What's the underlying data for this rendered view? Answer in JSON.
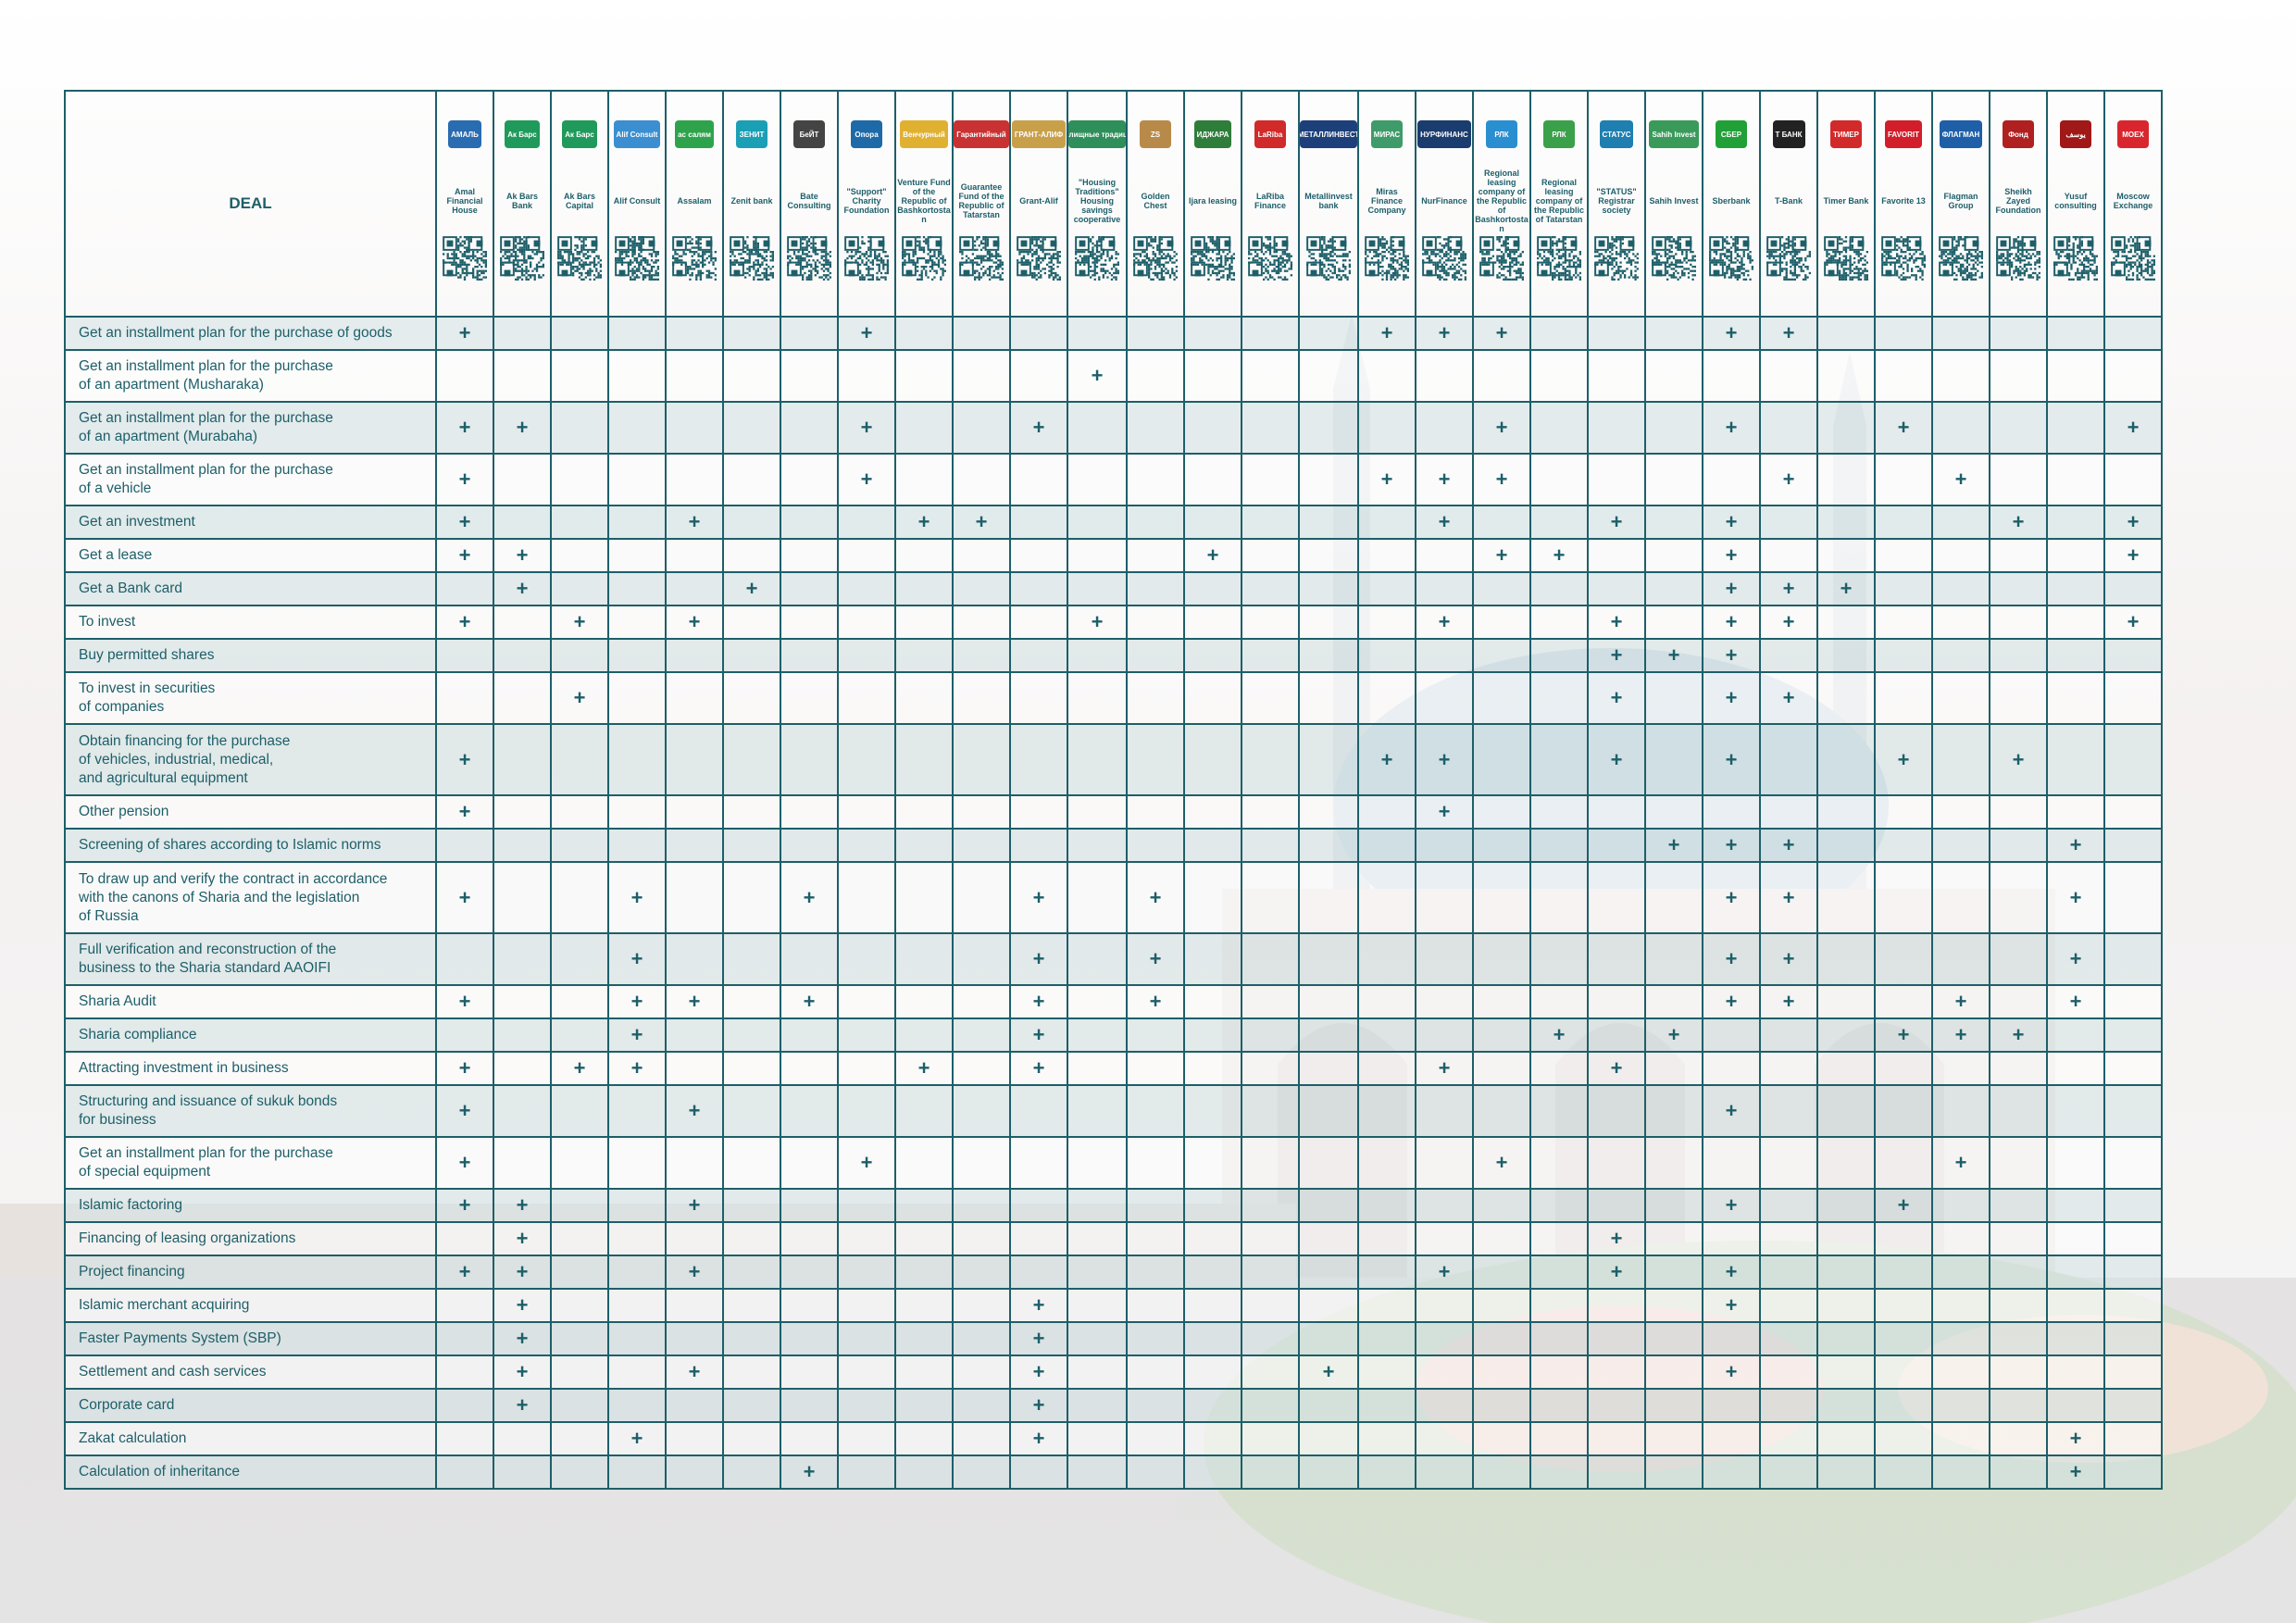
{
  "header_label": "DEAL",
  "colors": {
    "line": "#1d5f69",
    "text": "#1d5f69",
    "zebra": "#dfe9eb"
  },
  "organizations": [
    {
      "name": "Amal Financial House",
      "logo": "АМАЛЬ",
      "icon": "amal-logo-icon",
      "color": "#2a6cb0"
    },
    {
      "name": "Ak Bars Bank",
      "logo": "Ак Барс",
      "icon": "akbars-bank-logo-icon",
      "color": "#1f9a5a"
    },
    {
      "name": "Ak Bars Capital",
      "logo": "Ак Барс",
      "icon": "akbars-capital-logo-icon",
      "color": "#1f9a5a"
    },
    {
      "name": "Alif Consult",
      "logo": "Alif Consult",
      "icon": "alif-logo-icon",
      "color": "#3b8fd0"
    },
    {
      "name": "Assalam",
      "logo": "ас салям",
      "icon": "assalam-logo-icon",
      "color": "#2fa34c"
    },
    {
      "name": "Zenit bank",
      "logo": "ЗЕНИТ",
      "icon": "zenit-logo-icon",
      "color": "#1a9fb5"
    },
    {
      "name": "Bate Consulting",
      "logo": "БеЙТ",
      "icon": "bate-logo-icon",
      "color": "#444444"
    },
    {
      "name": "\"Support\" Charity Foundation",
      "logo": "Опора",
      "icon": "support-foundation-logo-icon",
      "color": "#1e6aa8"
    },
    {
      "name": "Venture Fund of the Republic of Bashkortostan",
      "logo": "Венчурный",
      "icon": "venture-fund-logo-icon",
      "color": "#e0b030"
    },
    {
      "name": "Guarantee Fund of the Republic of Tatarstan",
      "logo": "Гарантийный",
      "icon": "guarantee-fund-logo-icon",
      "color": "#c83232"
    },
    {
      "name": "Grant-Alif",
      "logo": "ГРАНТ-АЛИФ",
      "icon": "grant-alif-logo-icon",
      "color": "#c9a04a"
    },
    {
      "name": "\"Housing Traditions\" Housing savings cooperative",
      "logo": "Жилищные традиции",
      "icon": "housing-traditions-logo-icon",
      "color": "#2f8f5a"
    },
    {
      "name": "Golden Chest",
      "logo": "ZS",
      "icon": "golden-chest-logo-icon",
      "color": "#b88a4a"
    },
    {
      "name": "Ijara leasing",
      "logo": "ИДЖАРА",
      "icon": "ijara-logo-icon",
      "color": "#2f7d3a"
    },
    {
      "name": "LaRiba Finance",
      "logo": "LaRiba",
      "icon": "lariba-logo-icon",
      "color": "#d02a2a"
    },
    {
      "name": "Metallinvest bank",
      "logo": "МЕТАЛЛИНВЕСТ",
      "icon": "metallinvest-logo-icon",
      "color": "#1d3f7a"
    },
    {
      "name": "Miras Finance Company",
      "logo": "МИРАС",
      "icon": "miras-logo-icon",
      "color": "#3f9b6a"
    },
    {
      "name": "NurFinance",
      "logo": "НУРФИНАНС",
      "icon": "nurfinance-logo-icon",
      "color": "#1b3c6e"
    },
    {
      "name": "Regional leasing company of the Republic of Bashkortostan",
      "logo": "РЛК",
      "icon": "rlk-bashkortostan-logo-icon",
      "color": "#2a8fd0"
    },
    {
      "name": "Regional leasing company of the Republic of Tatarstan",
      "logo": "РЛК",
      "icon": "rlk-tatarstan-logo-icon",
      "color": "#3aa04a"
    },
    {
      "name": "\"STATUS\" Registrar society",
      "logo": "СТАТУС",
      "icon": "status-logo-icon",
      "color": "#1f7fb0"
    },
    {
      "name": "Sahih Invest",
      "logo": "Sahih Invest",
      "icon": "sahih-logo-icon",
      "color": "#3a9a5a"
    },
    {
      "name": "Sberbank",
      "logo": "СБЕР",
      "icon": "sber-logo-icon",
      "color": "#21a038"
    },
    {
      "name": "T-Bank",
      "logo": "Т БАНК",
      "icon": "tbank-logo-icon",
      "color": "#222222"
    },
    {
      "name": "Timer Bank",
      "logo": "ТИМЕР",
      "icon": "timer-bank-logo-icon",
      "color": "#d22a2a"
    },
    {
      "name": "Favorite 13",
      "logo": "FAVORIT",
      "icon": "favorite13-logo-icon",
      "color": "#d21e2a"
    },
    {
      "name": "Flagman Group",
      "logo": "ФЛАГМАН",
      "icon": "flagman-logo-icon",
      "color": "#1e5fa8"
    },
    {
      "name": "Sheikh Zayed Foundation",
      "logo": "Фонд",
      "icon": "zayed-foundation-logo-icon",
      "color": "#b02020"
    },
    {
      "name": "Yusuf consulting",
      "logo": "يوسف",
      "icon": "yusuf-logo-icon",
      "color": "#a01818"
    },
    {
      "name": "Moscow Exchange",
      "logo": "MOEX",
      "icon": "moex-logo-icon",
      "color": "#d9262e"
    }
  ],
  "rows": [
    {
      "label": "Get an installment plan for the purchase of goods",
      "marks": [
        0,
        7,
        16,
        17,
        18,
        22,
        23
      ]
    },
    {
      "label": "Get an installment plan for the purchase\nof an apartment (Musharaka)",
      "marks": [
        11
      ]
    },
    {
      "label": "Get an installment plan for the purchase\nof an apartment (Murabaha)",
      "marks": [
        0,
        1,
        7,
        10,
        18,
        22,
        25,
        29
      ]
    },
    {
      "label": "Get an installment plan for the purchase\nof a vehicle",
      "marks": [
        0,
        7,
        16,
        17,
        18,
        23,
        26
      ]
    },
    {
      "label": "Get an investment",
      "marks": [
        0,
        4,
        8,
        9,
        17,
        20,
        22,
        27,
        29
      ]
    },
    {
      "label": "Get a lease",
      "marks": [
        0,
        1,
        13,
        18,
        19,
        22,
        29
      ]
    },
    {
      "label": "Get a Bank card",
      "marks": [
        1,
        5,
        22,
        23,
        24
      ]
    },
    {
      "label": "To invest",
      "marks": [
        0,
        2,
        4,
        11,
        17,
        20,
        22,
        23,
        29
      ]
    },
    {
      "label": "Buy permitted shares",
      "marks": [
        20,
        21,
        22
      ]
    },
    {
      "label": "To invest in securities\nof companies",
      "marks": [
        2,
        20,
        22,
        23
      ]
    },
    {
      "label": "Obtain financing for the purchase\nof vehicles, industrial, medical,\nand agricultural equipment",
      "marks": [
        0,
        16,
        17,
        20,
        22,
        25,
        27
      ]
    },
    {
      "label": "Other pension",
      "marks": [
        0,
        17
      ]
    },
    {
      "label": "Screening of shares according to Islamic norms",
      "marks": [
        21,
        22,
        23,
        28
      ]
    },
    {
      "label": "To draw up and verify the contract in accordance\nwith the canons of Sharia and the legislation\nof Russia",
      "marks": [
        0,
        3,
        6,
        10,
        12,
        22,
        23,
        28
      ]
    },
    {
      "label": "Full verification and reconstruction of the\nbusiness to the Sharia standard AAOIFI",
      "marks": [
        3,
        10,
        12,
        22,
        23,
        28
      ]
    },
    {
      "label": "Sharia Audit",
      "marks": [
        0,
        3,
        4,
        6,
        10,
        12,
        22,
        23,
        26,
        28
      ]
    },
    {
      "label": "Sharia compliance",
      "marks": [
        3,
        10,
        19,
        21,
        25,
        26,
        27
      ]
    },
    {
      "label": "Attracting investment in business",
      "marks": [
        0,
        2,
        3,
        8,
        10,
        17,
        20
      ]
    },
    {
      "label": "Structuring and issuance of sukuk bonds\nfor business",
      "marks": [
        0,
        4,
        22
      ]
    },
    {
      "label": "Get an installment plan for the purchase\nof special equipment",
      "marks": [
        0,
        7,
        18,
        26
      ]
    },
    {
      "label": "Islamic factoring",
      "marks": [
        0,
        1,
        4,
        22,
        25
      ]
    },
    {
      "label": "Financing of leasing organizations",
      "marks": [
        1,
        20
      ]
    },
    {
      "label": "Project financing",
      "marks": [
        0,
        1,
        4,
        17,
        20,
        22
      ]
    },
    {
      "label": "Islamic merchant acquiring",
      "marks": [
        1,
        10,
        22
      ]
    },
    {
      "label": "Faster Payments System (SBP)",
      "marks": [
        1,
        10
      ]
    },
    {
      "label": "Settlement and cash services",
      "marks": [
        1,
        4,
        10,
        15,
        22
      ]
    },
    {
      "label": "Corporate card",
      "marks": [
        1,
        10
      ]
    },
    {
      "label": "Zakat calculation",
      "marks": [
        3,
        10,
        28
      ]
    },
    {
      "label": "Calculation of inheritance",
      "marks": [
        6,
        28
      ]
    }
  ],
  "mark_symbol": "+"
}
